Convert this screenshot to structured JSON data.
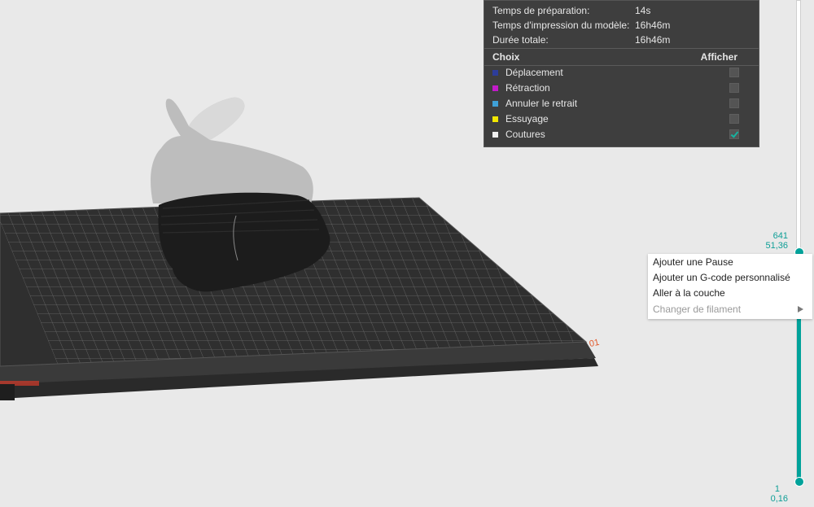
{
  "stats": [
    {
      "label": "Temps de préparation:",
      "value": "14s"
    },
    {
      "label": "Temps d'impression du modèle:",
      "value": "16h46m"
    },
    {
      "label": "Durée totale:",
      "value": "16h46m"
    }
  ],
  "legend": {
    "header_left": "Choix",
    "header_right": "Afficher",
    "items": [
      {
        "label": "Déplacement",
        "color": "#2d3d9b",
        "checked": false
      },
      {
        "label": "Rétraction",
        "color": "#c21bc9",
        "checked": false
      },
      {
        "label": "Annuler le retrait",
        "color": "#3fa0d6",
        "checked": false
      },
      {
        "label": "Essuyage",
        "color": "#f2e600",
        "checked": false
      },
      {
        "label": "Coutures",
        "color": "#f0f0f0",
        "checked": true
      }
    ]
  },
  "layer_slider": {
    "top_layer": "641",
    "top_height": "51,36",
    "bottom_layer": "1",
    "bottom_height": "0,16",
    "accent": "#00a29a"
  },
  "context_menu": {
    "items": [
      {
        "label": "Ajouter une Pause",
        "enabled": true
      },
      {
        "label": "Ajouter un G-code personnalisé",
        "enabled": true
      },
      {
        "label": "Aller à la couche",
        "enabled": true
      },
      {
        "label": "Changer de filament",
        "enabled": false,
        "submenu": true
      }
    ]
  },
  "bed": {
    "corner_label": "01"
  }
}
